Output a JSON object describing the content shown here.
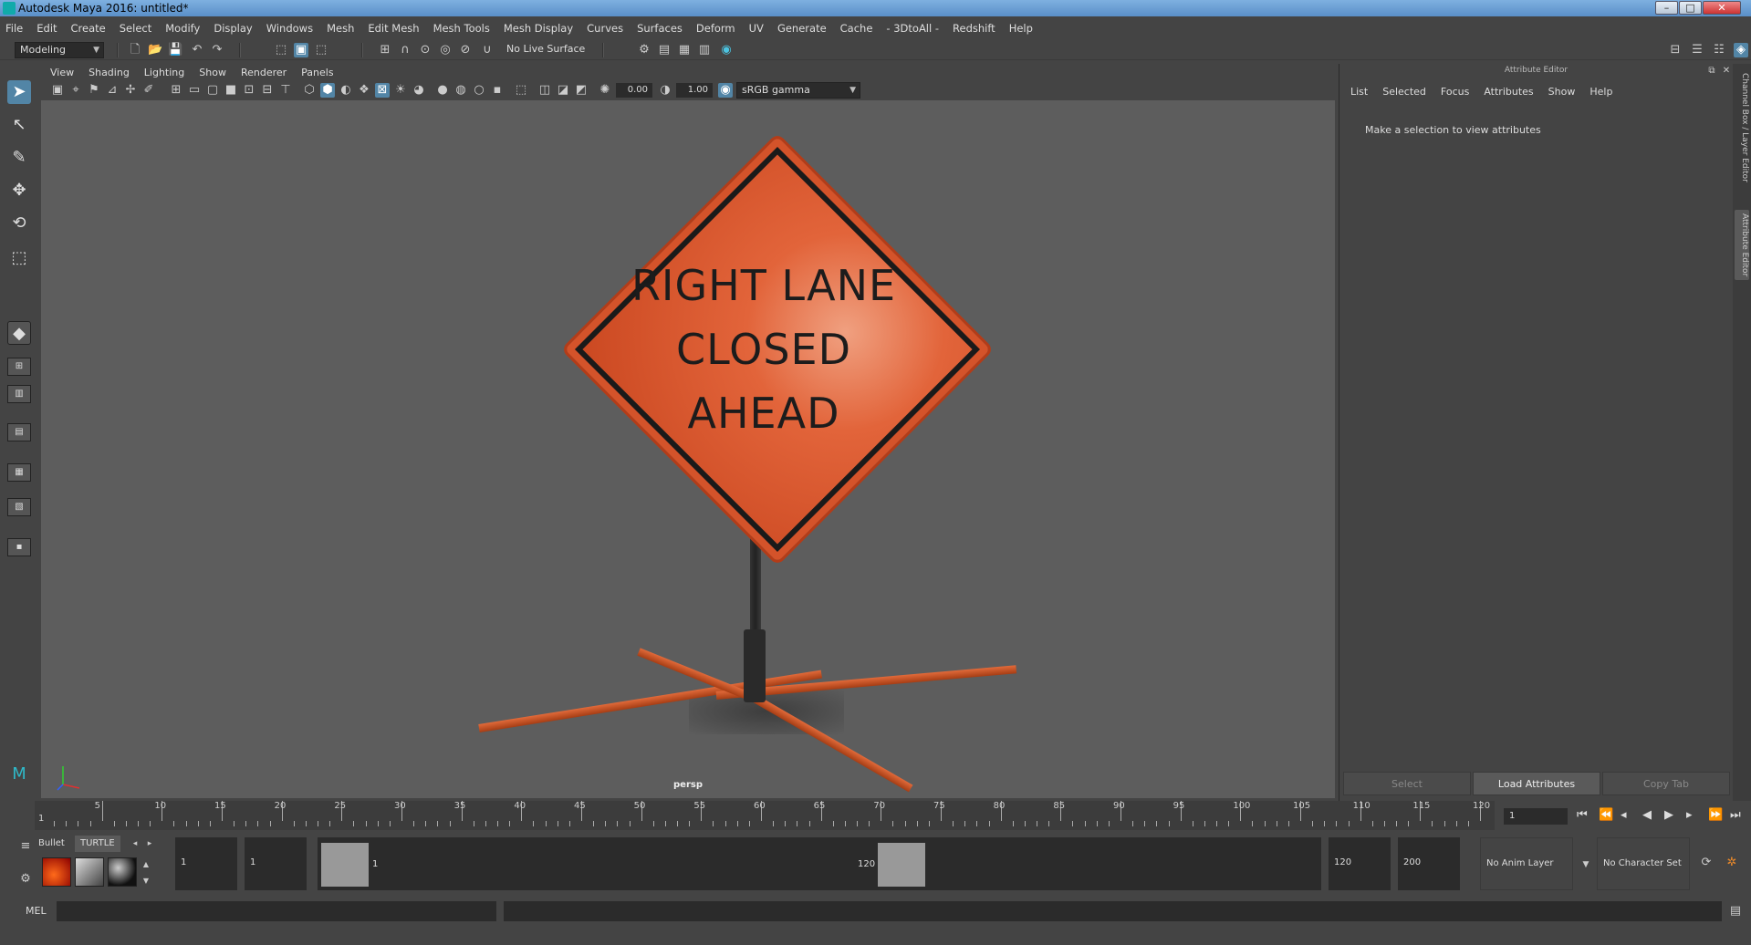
{
  "window": {
    "title": "Autodesk Maya 2016: untitled*",
    "minimize": "–",
    "maximize": "□",
    "close": "✕"
  },
  "menu": [
    "File",
    "Edit",
    "Create",
    "Select",
    "Modify",
    "Display",
    "Windows",
    "Mesh",
    "Edit Mesh",
    "Mesh Tools",
    "Mesh Display",
    "Curves",
    "Surfaces",
    "Deform",
    "UV",
    "Generate",
    "Cache",
    "- 3DtoAll -",
    "Redshift",
    "Help"
  ],
  "statusline": {
    "mode": "Modeling",
    "live_surface": "No Live Surface"
  },
  "panel": {
    "menu": [
      "View",
      "Shading",
      "Lighting",
      "Show",
      "Renderer",
      "Panels"
    ],
    "exposure": "0.00",
    "gamma": "1.00",
    "color_space": "sRGB gamma",
    "camera": "persp"
  },
  "scene": {
    "sign_lines": [
      "RIGHT LANE",
      "CLOSED",
      "AHEAD"
    ],
    "sign_color": "#e2643a",
    "leg_color": "#c9501f"
  },
  "attribute_editor": {
    "title": "Attribute Editor",
    "menu": [
      "List",
      "Selected",
      "Focus",
      "Attributes",
      "Show",
      "Help"
    ],
    "message": "Make a selection to view attributes",
    "buttons": {
      "select": "Select",
      "load": "Load Attributes",
      "copy": "Copy Tab"
    }
  },
  "side_tabs": {
    "channel": "Channel Box / Layer Editor",
    "attr": "Attribute Editor"
  },
  "timeline": {
    "ticks": [
      "5",
      "10",
      "15",
      "20",
      "25",
      "30",
      "35",
      "40",
      "45",
      "50",
      "55",
      "60",
      "65",
      "70",
      "75",
      "80",
      "85",
      "90",
      "95",
      "100",
      "105",
      "110",
      "115",
      "120"
    ],
    "start_label": "1",
    "current_frame": "1"
  },
  "shelf": {
    "tab_bullet": "Bullet",
    "tab_turtle": "TURTLE"
  },
  "range": {
    "start": "1",
    "playback_start": "1",
    "handle_start": "1",
    "handle_end": "120",
    "playback_end": "120",
    "end": "200",
    "anim_layer": "No Anim Layer",
    "character_set": "No Character Set"
  },
  "command": {
    "language": "MEL"
  }
}
